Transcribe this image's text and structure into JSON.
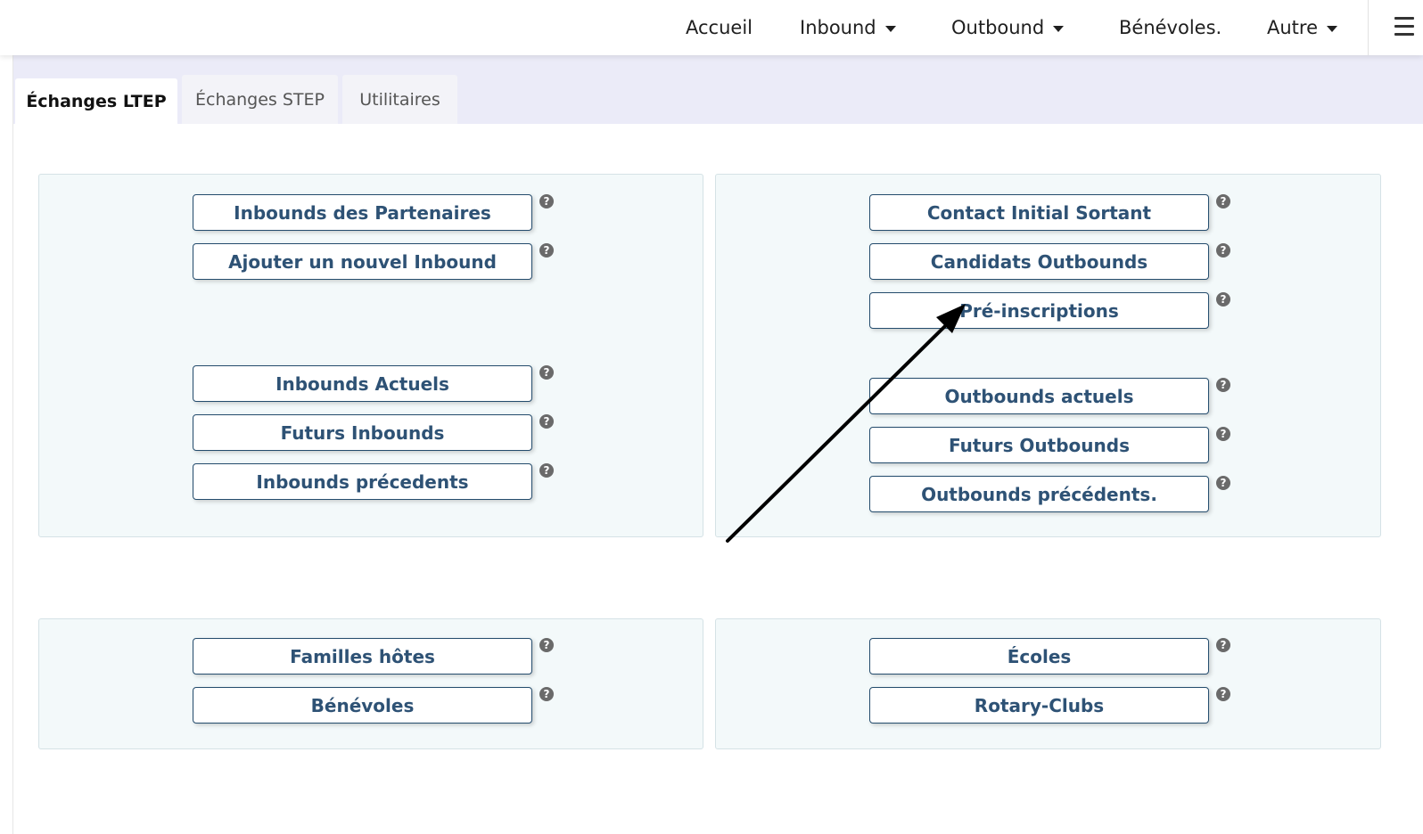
{
  "nav": {
    "home": "Accueil",
    "inbound": "Inbound",
    "outbound": "Outbound",
    "volunteers": "Bénévoles.",
    "other": "Autre",
    "menu_icon": "hamburger-menu-icon"
  },
  "tabs": {
    "ltep": "Échanges LTEP",
    "step": "Échanges STEP",
    "utilities": "Utilitaires"
  },
  "inbound_panel": {
    "partners": "Inbounds des Partenaires",
    "add_new": "Ajouter un nouvel Inbound",
    "current": "Inbounds Actuels",
    "future": "Futurs Inbounds",
    "previous": "Inbounds précedents"
  },
  "outbound_panel": {
    "initial_contact": "Contact Initial Sortant",
    "candidates": "Candidats Outbounds",
    "preregistrations": "Pré-inscriptions",
    "current": "Outbounds actuels",
    "future": "Futurs Outbounds",
    "previous": "Outbounds précédents."
  },
  "people_panel": {
    "host_families": "Familles hôtes",
    "volunteers": "Bénévoles"
  },
  "orgs_panel": {
    "schools": "Écoles",
    "rotary_clubs": "Rotary-Clubs"
  },
  "help_glyph": "?",
  "colors": {
    "button_text": "#2e5275",
    "button_border": "#244c6d",
    "panel_bg": "#f3f9fa",
    "tabbar_bg": "#ebebf8",
    "help_icon": "#6a6a6a",
    "annotation_arrow": "#000000"
  }
}
